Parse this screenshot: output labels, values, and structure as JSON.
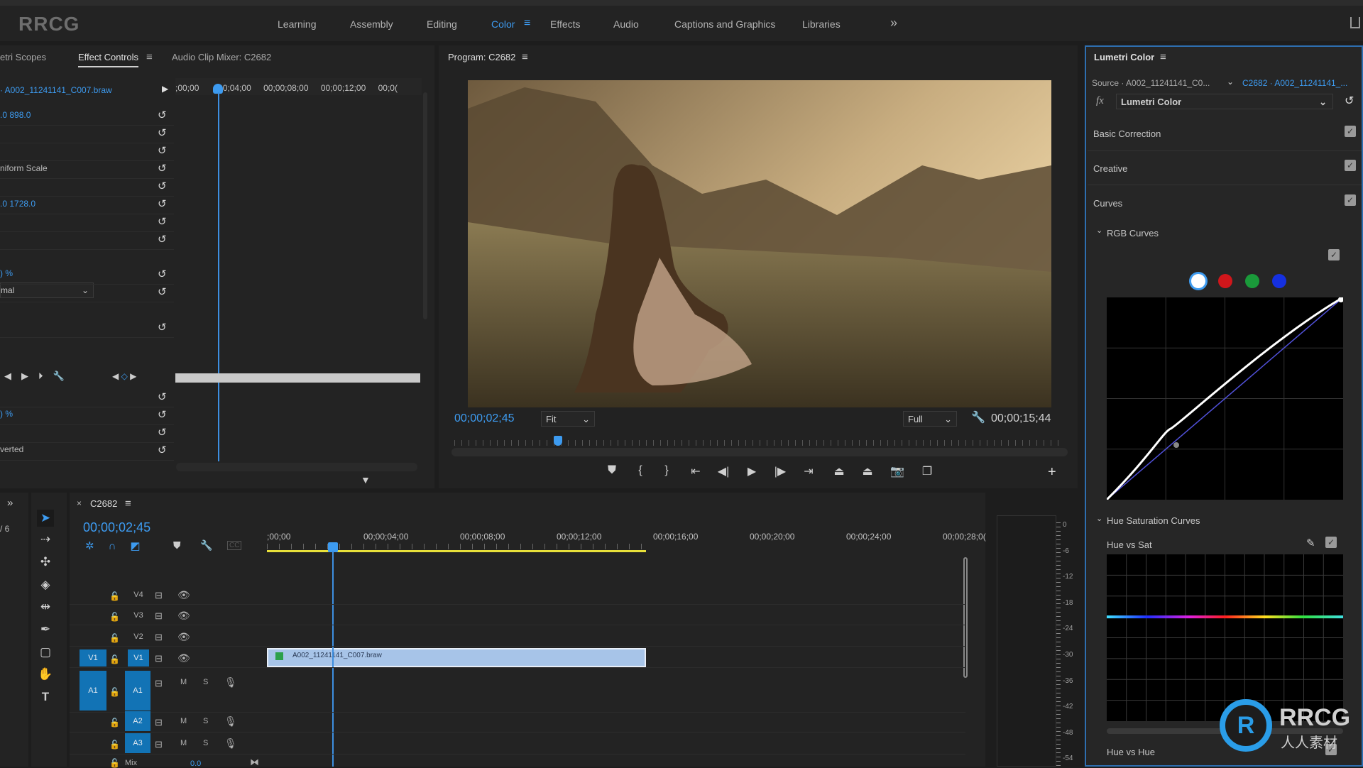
{
  "watermark": {
    "logo_text": "RRCG",
    "badge_text": "RRCG",
    "badge_subtext": "人人素材"
  },
  "workspaces": [
    {
      "label": "Learning"
    },
    {
      "label": "Assembly"
    },
    {
      "label": "Editing"
    },
    {
      "label": "Color",
      "active": true
    },
    {
      "label": "Effects"
    },
    {
      "label": "Audio"
    },
    {
      "label": "Captions and Graphics"
    },
    {
      "label": "Libraries"
    }
  ],
  "workspace_overflow": "»",
  "left_panel": {
    "tabs": [
      "etri Scopes",
      "Effect Controls",
      "Audio Clip Mixer: C2682"
    ],
    "clip_name": "· A002_11241141_C007.braw",
    "ruler": [
      ";00;00",
      ";00;04;00",
      "00;00;08;00",
      "00;00;12;00",
      "00;0("
    ],
    "rows": {
      "position": ".0   898.0",
      "uniform_scale": "niform Scale",
      "anchor": ".0   1728.0",
      "opacity": ") %",
      "blend": "mal",
      "speed": ") %",
      "inverted": "verted"
    }
  },
  "program": {
    "title": "Program: C2682",
    "timecode": "00;00;02;45",
    "zoom": "Fit",
    "quality": "Full",
    "duration": "00;00;15;44",
    "playhead_fraction": 0.17
  },
  "lumetri": {
    "title": "Lumetri Color",
    "source": "Source · A002_11241141_C0...",
    "target": "C2682 · A002_11241141_...",
    "effect": "Lumetri Color",
    "fx": "fx",
    "sections": [
      "Basic Correction",
      "Creative",
      "Curves"
    ],
    "rgb_curves": "RGB Curves",
    "channel_colors": [
      "#ffffff",
      "#d0161b",
      "#1a9a3a",
      "#1530e0"
    ],
    "hue_sat_curves": "Hue Saturation Curves",
    "hue_vs_sat": "Hue vs Sat",
    "hue_vs_hue": "Hue vs Hue"
  },
  "timeline": {
    "sequence": "C2682",
    "timecode": "00;00;02;45",
    "ruler": [
      ";00;00",
      "00;00;04;00",
      "00;00;08;00",
      "00;00;12;00",
      "00;00;16;00",
      "00;00;20;00",
      "00;00;24;00",
      "00;00;28;0("
    ],
    "video_tracks": [
      "V4",
      "V3",
      "V2",
      "V1"
    ],
    "audio_tracks": [
      "A1",
      "A2",
      "A3"
    ],
    "source_v": "V1",
    "source_a": "A1",
    "mix_label": "Mix",
    "mix_value": "0.0",
    "clip_name": "A002_11241141_C007.braw",
    "mute": "M",
    "solo": "S",
    "page_label": "/ 6",
    "meter_labels": [
      "0",
      "-6",
      "-12",
      "-18",
      "-24",
      "-30",
      "-36",
      "-42",
      "-48",
      "-54"
    ]
  }
}
